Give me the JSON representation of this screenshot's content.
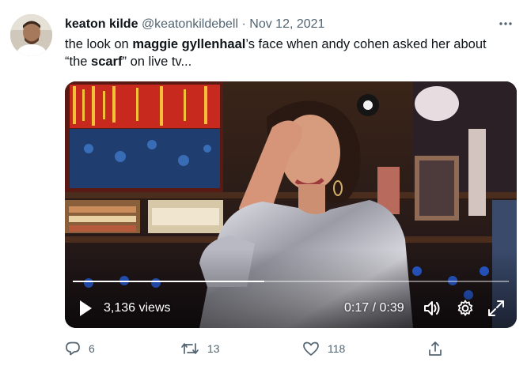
{
  "tweet": {
    "display_name": "keaton kilde",
    "handle": "@keatonkildebell",
    "separator": "·",
    "date": "Nov 12, 2021",
    "text": {
      "part1": "the look on ",
      "bold1": "maggie gyllenhaal",
      "part2": "’s face when andy cohen asked her about",
      "part3": "“the ",
      "bold2": "scarf",
      "part4": "” on live tv..."
    }
  },
  "video": {
    "views": "3,136 views",
    "time": "0:17 / 0:39",
    "progress": 0.44,
    "icons": [
      "play-icon",
      "volume-icon",
      "settings-gear-icon",
      "fullscreen-icon"
    ]
  },
  "actions": {
    "reply_count": "6",
    "retweet_count": "13",
    "like_count": "118"
  },
  "colors": {
    "text_primary": "#0f1419",
    "text_secondary": "#536471",
    "video_control_text": "#ffffff"
  }
}
